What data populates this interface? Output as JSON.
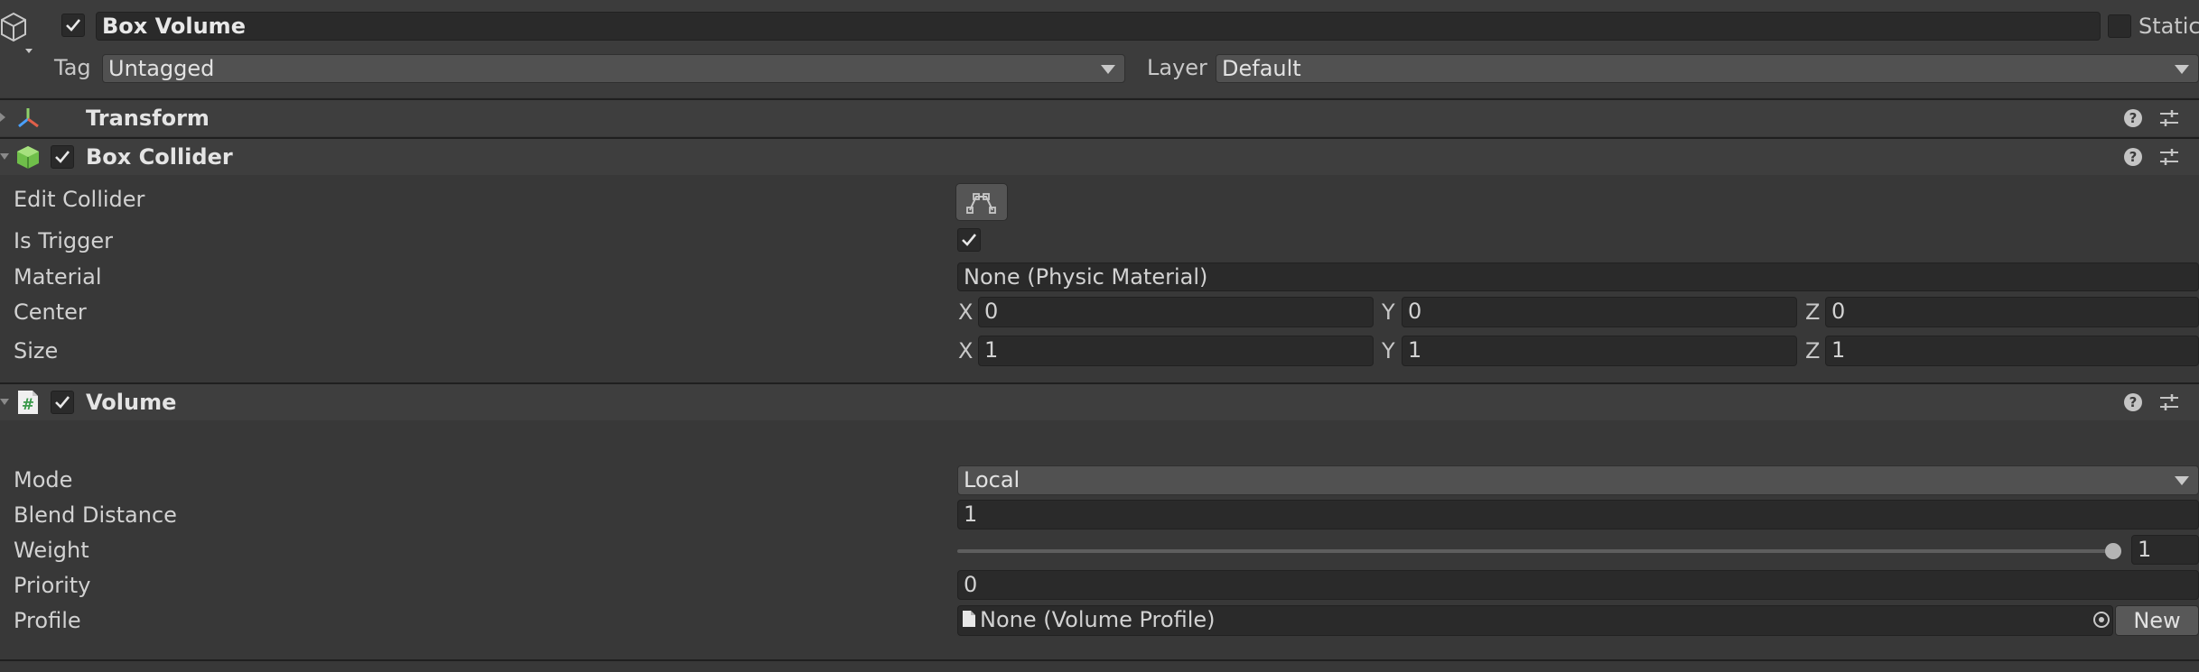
{
  "header": {
    "enabled": true,
    "object_name": "Box Volume",
    "static_label": "Static",
    "tag_label": "Tag",
    "tag_value": "Untagged",
    "layer_label": "Layer",
    "layer_value": "Default"
  },
  "components": {
    "transform": {
      "title": "Transform"
    },
    "box_collider": {
      "title": "Box Collider",
      "enabled": true,
      "edit_collider_label": "Edit Collider",
      "is_trigger_label": "Is Trigger",
      "is_trigger": true,
      "material_label": "Material",
      "material_value": "None (Physic Material)",
      "center_label": "Center",
      "center": {
        "x_label": "X",
        "x": "0",
        "y_label": "Y",
        "y": "0",
        "z_label": "Z",
        "z": "0"
      },
      "size_label": "Size",
      "size": {
        "x_label": "X",
        "x": "1",
        "y_label": "Y",
        "y": "1",
        "z_label": "Z",
        "z": "1"
      }
    },
    "volume": {
      "title": "Volume",
      "enabled": true,
      "mode_label": "Mode",
      "mode_value": "Local",
      "blend_distance_label": "Blend Distance",
      "blend_distance": "1",
      "weight_label": "Weight",
      "weight": "1",
      "priority_label": "Priority",
      "priority": "0",
      "profile_label": "Profile",
      "profile_value": "None (Volume Profile)",
      "new_button_label": "New"
    }
  },
  "icons": {
    "gameobject": "cube-outline-icon",
    "transform": "transform-axes-icon",
    "box_collider": "green-cube-icon",
    "volume": "script-hash-icon",
    "help": "help-icon",
    "presets": "sliders-icon",
    "edit_collider": "edit-collider-icon",
    "object_picker": "target-icon",
    "profile_file": "file-icon"
  },
  "colors": {
    "background": "#383838",
    "field": "#2a2a2a",
    "dropdown": "#515151",
    "collider_green": "#8fd16a"
  }
}
